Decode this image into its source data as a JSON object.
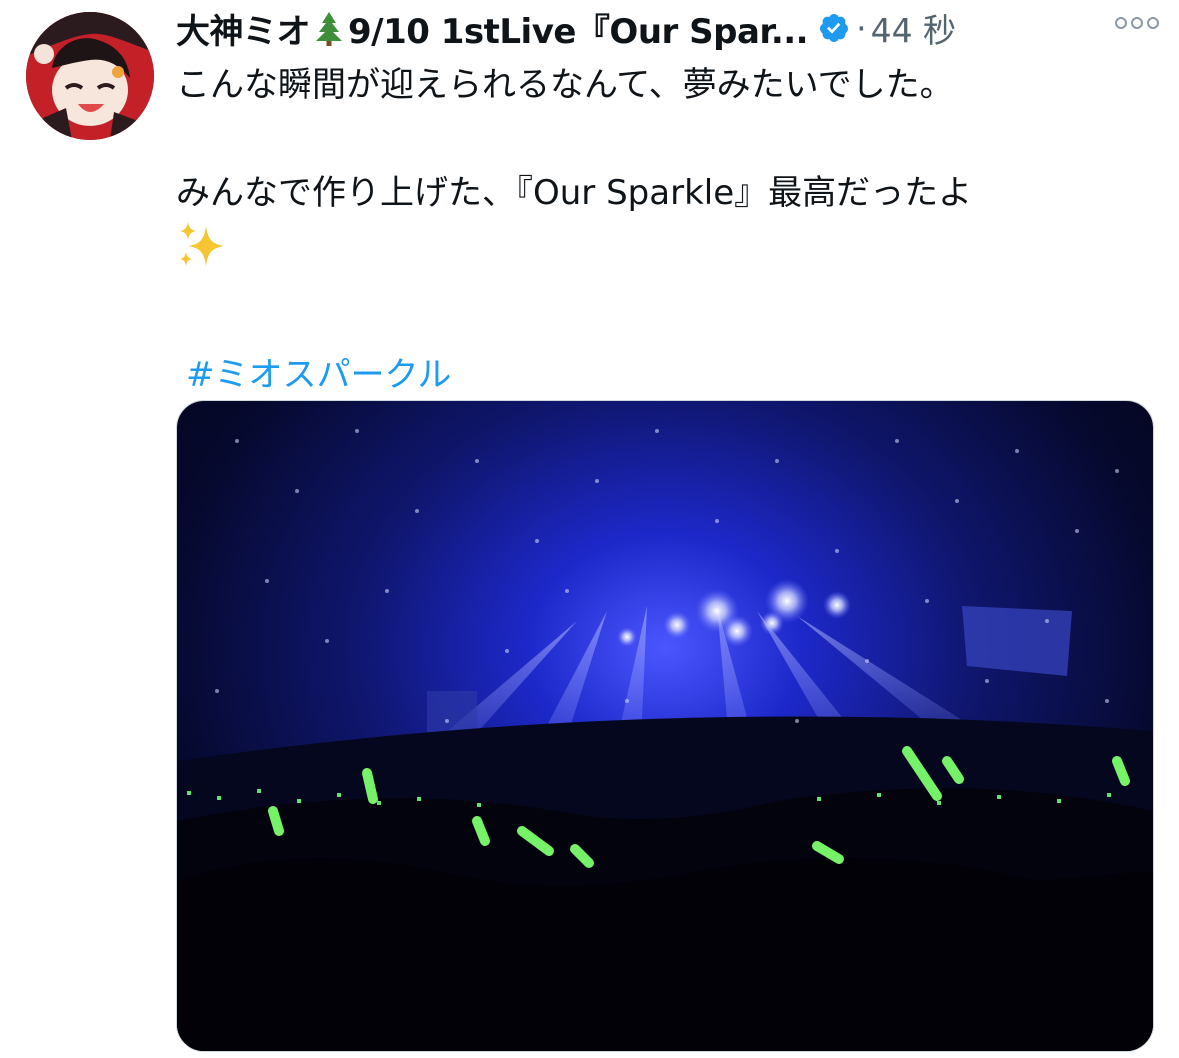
{
  "tweet": {
    "display_name": "大神ミオ",
    "name_suffix": "9/10 1stLive『Our Spar...",
    "separator": "·",
    "time": "44 秒",
    "lines": [
      "こんな瞬間が迎えられるなんて、夢みたいでした。",
      "みんなで作り上げた、『Our Sparkle』最高だったよ"
    ],
    "hashtag": "#ミオスパークル"
  },
  "icons": {
    "tree": "tree-emoji-icon",
    "verified": "verified-badge-icon",
    "more": "more-options-icon",
    "sparkles": "sparkles-emoji-icon"
  },
  "colors": {
    "link": "#1d9bf0",
    "muted": "#536471",
    "text": "#0f1419"
  }
}
